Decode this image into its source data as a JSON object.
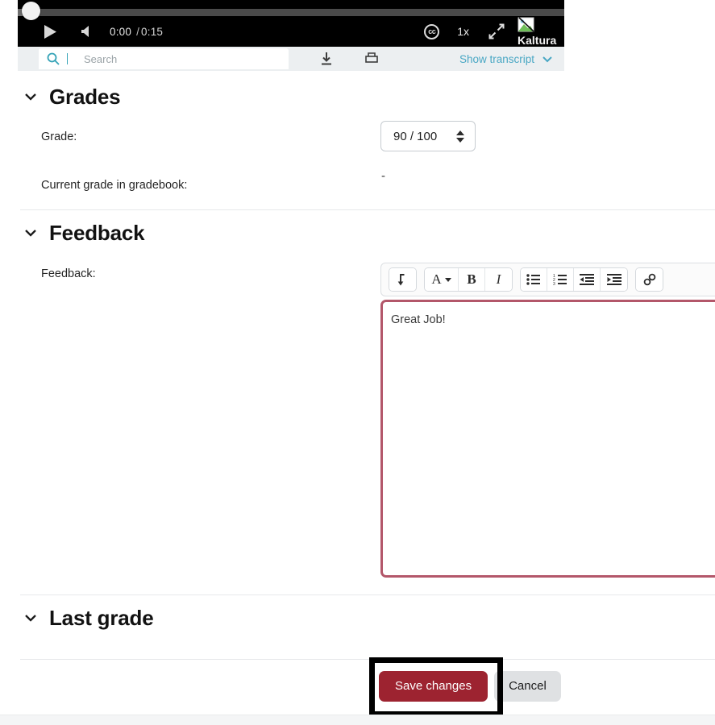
{
  "player": {
    "play_label": "play-button",
    "volume_label": "volume-button",
    "current_time": "0:00",
    "time_separator": "/",
    "total_time": "0:15",
    "cc_label": "cc",
    "speed_label": "1x",
    "fullscreen_label": "fullscreen-button",
    "logo_text": "Kaltura"
  },
  "transcript_bar": {
    "search_placeholder": "Search",
    "download_label": "download-icon",
    "print_label": "print-icon",
    "show_transcript_label": "Show transcript"
  },
  "grades": {
    "section_title": "Grades",
    "grade_label": "Grade:",
    "grade_value": "90 / 100",
    "current_grade_label": "Current grade in gradebook:",
    "current_grade_value": "-"
  },
  "feedback": {
    "section_title": "Feedback",
    "feedback_label": "Feedback:",
    "editor_content": "Great Job!",
    "toolbar": [
      {
        "name": "expand-toolbar-icon",
        "glyph": "arrow-down"
      },
      {
        "name": "font-style-icon",
        "glyph": "A"
      },
      {
        "name": "bold-icon",
        "glyph": "B"
      },
      {
        "name": "italic-icon",
        "glyph": "I"
      },
      {
        "name": "bullet-list-icon",
        "glyph": "bullets"
      },
      {
        "name": "numbered-list-icon",
        "glyph": "numbers"
      },
      {
        "name": "decrease-indent-icon",
        "glyph": "outdent"
      },
      {
        "name": "increase-indent-icon",
        "glyph": "indent"
      },
      {
        "name": "link-icon",
        "glyph": "chain"
      }
    ]
  },
  "last_grade": {
    "section_title": "Last grade"
  },
  "actions": {
    "save_label": "Save changes",
    "cancel_label": "Cancel"
  },
  "colors": {
    "accent_red": "#9d2330",
    "focus_border": "#b3576a",
    "link_blue": "#49a7c4",
    "annotation": "#000000"
  }
}
